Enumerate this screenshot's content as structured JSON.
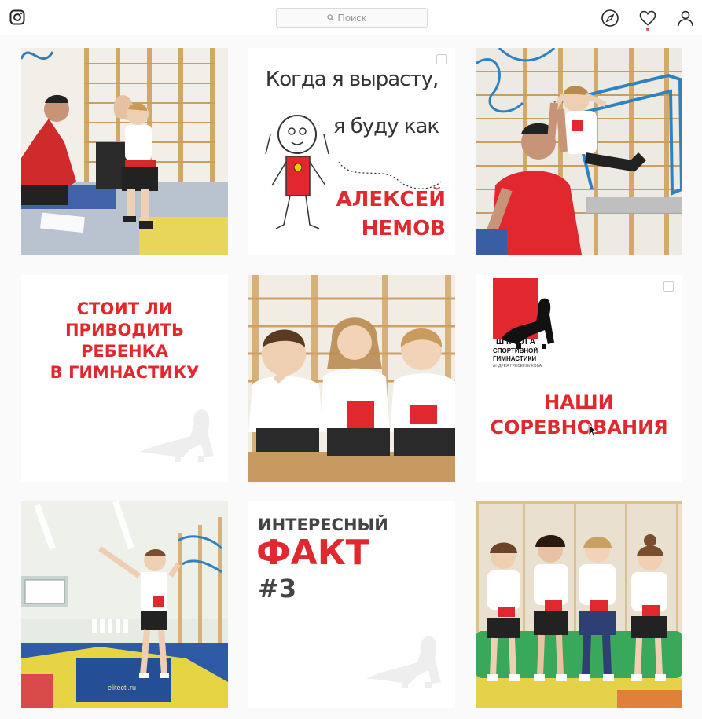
{
  "header": {
    "search_placeholder": "Поиск",
    "icons": [
      "instagram-logo-icon",
      "search-icon",
      "compass-icon",
      "heart-icon",
      "profile-icon"
    ],
    "notification_dot_color": "#ed4956"
  },
  "grid": {
    "post2": {
      "line1": "Когда я вырасту,",
      "line2": "я буду как",
      "name1": "АЛЕКСЕЙ",
      "name2": "НЕМОВ"
    },
    "post4": {
      "lines": [
        "СТОИТ ЛИ",
        "ПРИВОДИТЬ",
        "РЕБЕНКА",
        "В ГИМНАСТИКУ"
      ]
    },
    "post6": {
      "logo_word": "ШКОЛА",
      "logo_line1": "СПОРТИВНОЙ",
      "logo_line2": "ГИМНАСТИКИ",
      "logo_line3": "АНДРЕЯ ГРЕБЕННИКОВА",
      "title1": "НАШИ",
      "title2": "СОРЕВНОВАНИЯ"
    },
    "post7": {
      "mat_brand": "elitecti.ru"
    },
    "post8": {
      "line1": "ИНТЕРЕСНЫЙ",
      "line2": "ФАКТ",
      "line3": "#3"
    }
  },
  "colors": {
    "brand_red": "#e0282e",
    "dark_text": "#333333",
    "border": "#dbdbdb"
  }
}
